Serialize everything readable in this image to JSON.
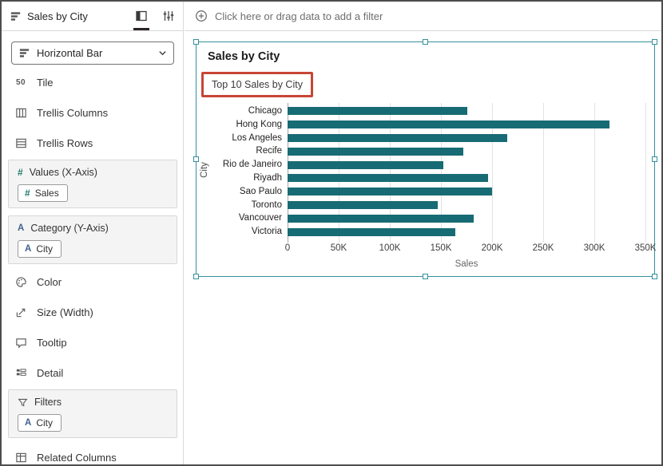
{
  "sidebar": {
    "title": "Sales by City",
    "viz_type": "Horizontal Bar",
    "items": [
      {
        "icon_text": "50",
        "label": "Tile"
      },
      {
        "label": "Trellis Columns"
      },
      {
        "label": "Trellis Rows"
      }
    ],
    "sections": {
      "values": {
        "label": "Values (X-Axis)",
        "chip": {
          "prefix": "#",
          "label": "Sales"
        }
      },
      "category": {
        "label": "Category (Y-Axis)",
        "chip": {
          "prefix": "A",
          "label": "City"
        }
      },
      "filters": {
        "label": "Filters",
        "chip": {
          "prefix": "A",
          "label": "City"
        }
      }
    },
    "props": [
      {
        "label": "Color"
      },
      {
        "label": "Size (Width)"
      },
      {
        "label": "Tooltip"
      },
      {
        "label": "Detail"
      }
    ],
    "related_label": "Related Columns",
    "section_icon_hash": "#",
    "section_icon_a": "A"
  },
  "filter_bar": {
    "text": "Click here or drag data to add a filter"
  },
  "viz": {
    "title": "Sales by City",
    "subtitle": "Top 10 Sales by City"
  },
  "chart_data": {
    "type": "bar",
    "orientation": "horizontal",
    "title": "Sales by City",
    "subtitle": "Top 10 Sales by City",
    "categories": [
      "Chicago",
      "Hong Kong",
      "Los Angeles",
      "Recife",
      "Rio de Janeiro",
      "Riyadh",
      "Sao Paulo",
      "Toronto",
      "Vancouver",
      "Victoria"
    ],
    "values": [
      176000,
      315000,
      215000,
      172000,
      152000,
      196000,
      200000,
      147000,
      182000,
      164000
    ],
    "x_ticks": [
      "0",
      "50K",
      "100K",
      "150K",
      "200K",
      "250K",
      "300K",
      "350K"
    ],
    "xlim": [
      0,
      350000
    ],
    "xlabel": "Sales",
    "ylabel": "City",
    "grid": true,
    "legend": false,
    "bar_color": "#176b74"
  },
  "colors": {
    "selection_accent": "#35919e",
    "bar": "#176b74",
    "annotation_red": "#c74634",
    "measure_icon": "#1f7a6e",
    "attribute_icon": "#41638f"
  }
}
